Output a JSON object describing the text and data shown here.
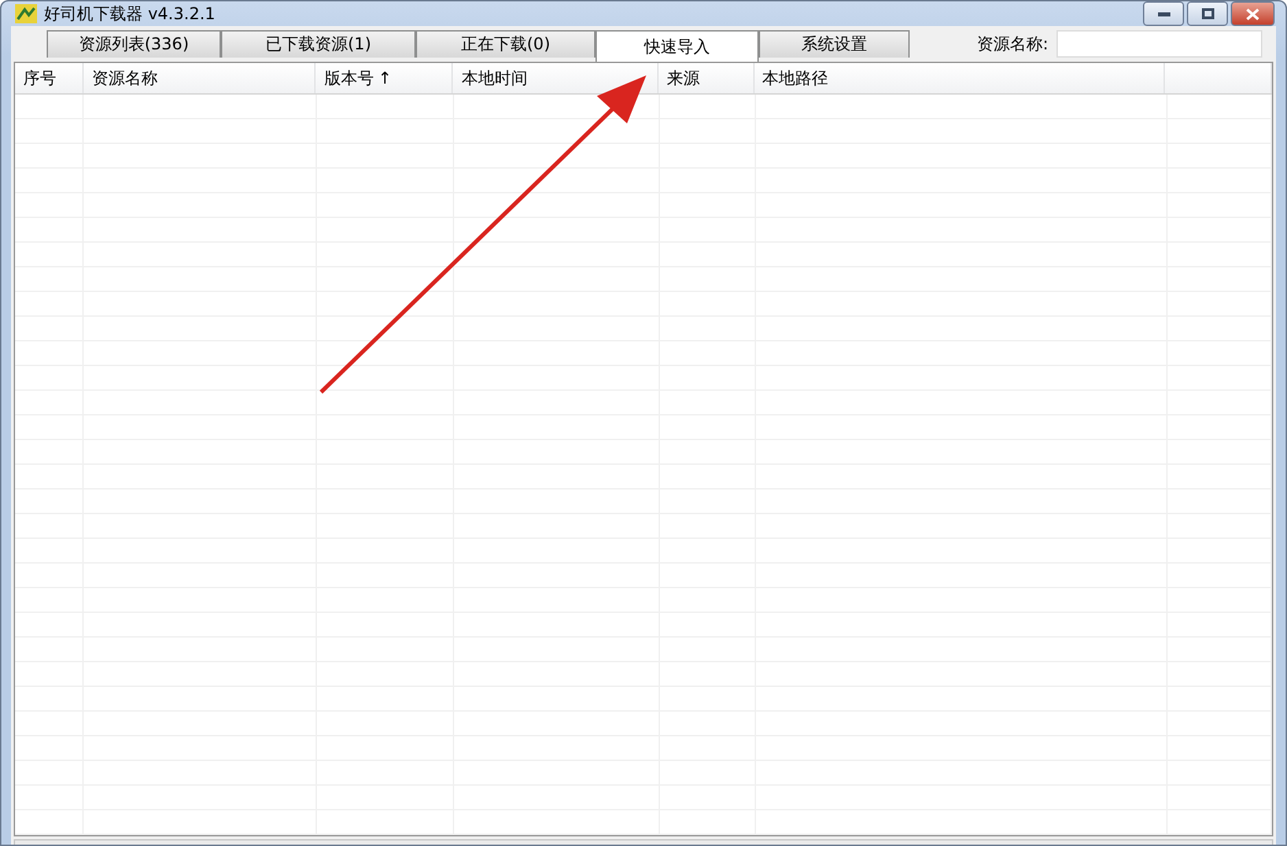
{
  "window": {
    "title": "好司机下载器 v4.3.2.1"
  },
  "tabs": [
    {
      "label": "资源列表(336)",
      "selected": false
    },
    {
      "label": "已下载资源(1)",
      "selected": false
    },
    {
      "label": "正在下载(0)",
      "selected": false
    },
    {
      "label": "快速导入",
      "selected": true
    },
    {
      "label": "系统设置",
      "selected": false
    }
  ],
  "search": {
    "label": "资源名称:"
  },
  "table": {
    "columns": [
      {
        "label": "序号"
      },
      {
        "label": "资源名称"
      },
      {
        "label": "版本号",
        "sort_indicator": "↑"
      },
      {
        "label": "本地时间"
      },
      {
        "label": "来源"
      },
      {
        "label": "本地路径"
      }
    ]
  },
  "annotation": {
    "kind": "arrow",
    "color": "#d9251f"
  }
}
